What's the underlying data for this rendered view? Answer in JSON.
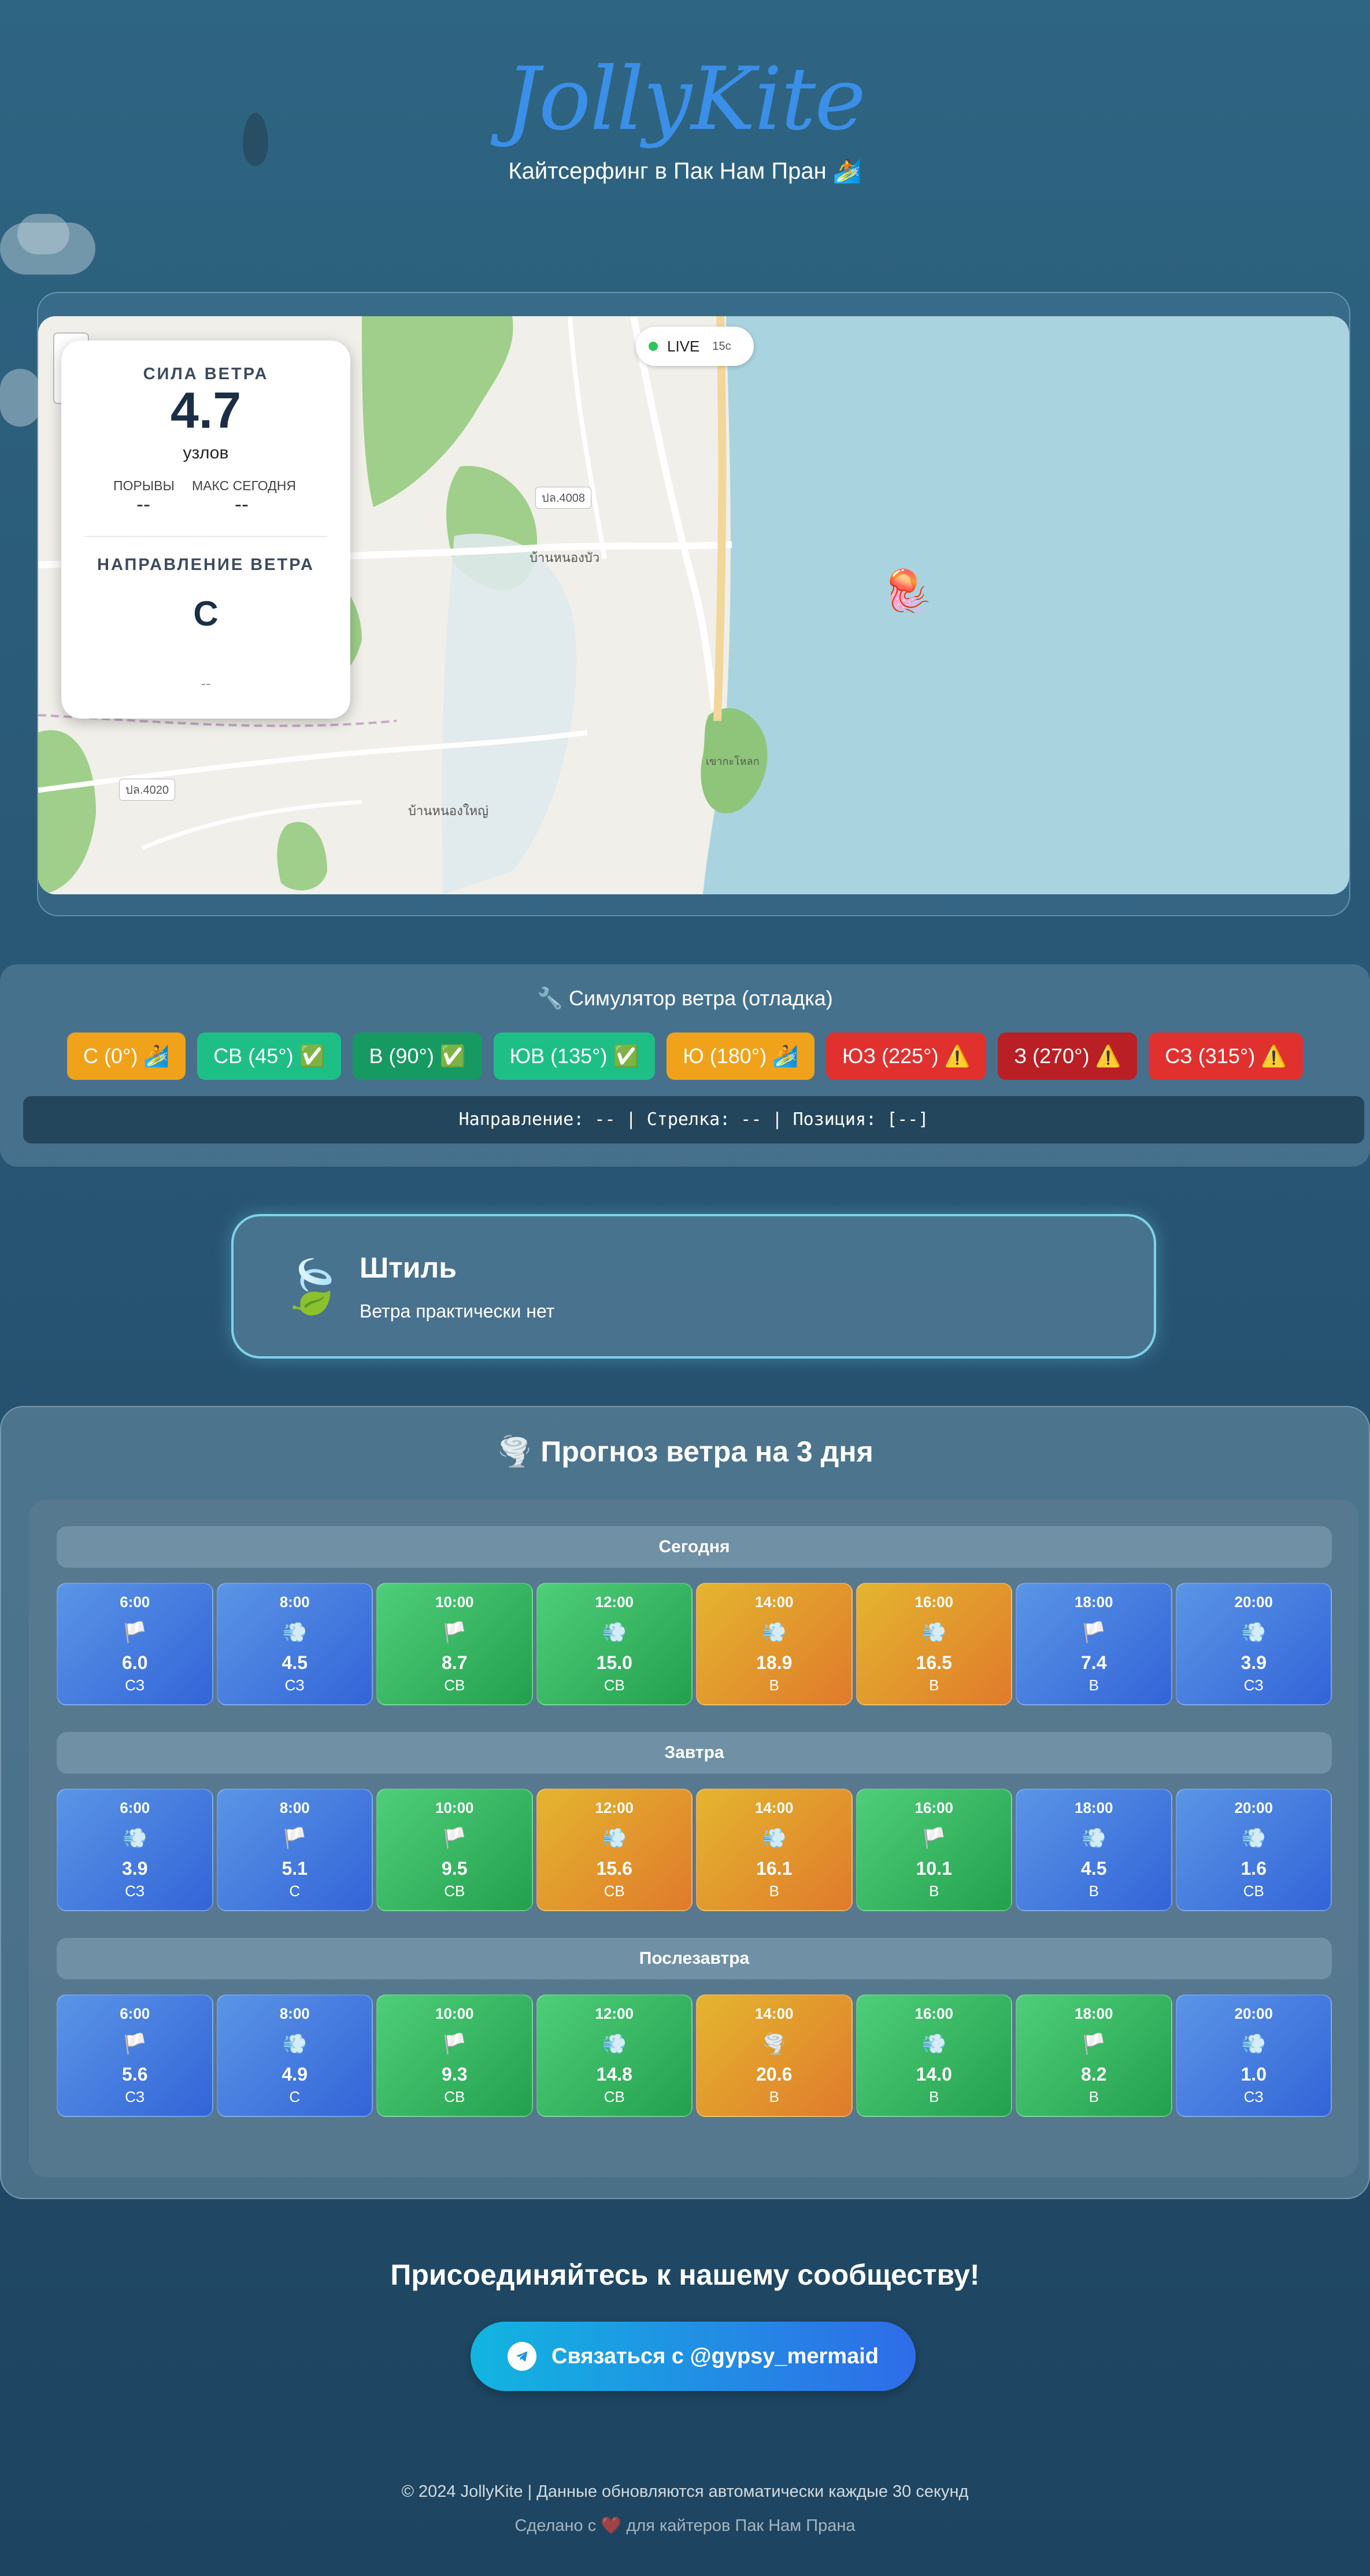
{
  "header": {
    "logo": "JollyKite",
    "subtitle": "Кайтсерфинг в Пак Нам Пран 🏄"
  },
  "map": {
    "live_label": "LIVE",
    "live_age": "15с",
    "place_labels": [
      "ปล.4008",
      "บ้านหนองบัว",
      "บ้านหนองใหญ่",
      "ปล.4020",
      "เขากะโหลก"
    ],
    "wind_card": {
      "speed_title": "СИЛА ВЕТРА",
      "speed_value": "4.7",
      "speed_unit": "узлов",
      "gusts_label": "ПОРЫВЫ",
      "gusts_value": "--",
      "max_today_label": "МАКС СЕГОДНЯ",
      "max_today_value": "--",
      "direction_title": "НАПРАВЛЕНИЕ ВЕТРА",
      "direction_value": "С",
      "direction_extra": "--"
    }
  },
  "simulator": {
    "title": "🔧 Симулятор ветра (отладка)",
    "buttons": [
      {
        "label": "С (0°)",
        "emoji": "🏄",
        "color": "#f0a21a"
      },
      {
        "label": "СВ (45°)",
        "emoji": "✅",
        "color": "#1dbf86"
      },
      {
        "label": "В (90°)",
        "emoji": "✅",
        "color": "#169a62"
      },
      {
        "label": "ЮВ (135°)",
        "emoji": "✅",
        "color": "#1dbf86"
      },
      {
        "label": "Ю (180°)",
        "emoji": "🏄",
        "color": "#f0a21a"
      },
      {
        "label": "ЮЗ (225°)",
        "emoji": "⚠️",
        "color": "#e0312f"
      },
      {
        "label": "З (270°)",
        "emoji": "⚠️",
        "color": "#b91f24"
      },
      {
        "label": "СЗ (315°)",
        "emoji": "⚠️",
        "color": "#e0312f"
      }
    ],
    "status": "Направление: -- | Стрелка: -- | Позиция: [--]"
  },
  "calm": {
    "icon": "🍃",
    "title": "Штиль",
    "description": "Ветра практически нет"
  },
  "forecast": {
    "title": "🌪️ Прогноз ветра на 3 дня",
    "days": [
      {
        "label": "Сегодня",
        "slots": [
          {
            "time": "6:00",
            "icon": "🏳️",
            "speed": "6.0",
            "dir": "СЗ",
            "level": "blue"
          },
          {
            "time": "8:00",
            "icon": "💨",
            "speed": "4.5",
            "dir": "СЗ",
            "level": "blue"
          },
          {
            "time": "10:00",
            "icon": "🏳️",
            "speed": "8.7",
            "dir": "СВ",
            "level": "green"
          },
          {
            "time": "12:00",
            "icon": "💨",
            "speed": "15.0",
            "dir": "СВ",
            "level": "green"
          },
          {
            "time": "14:00",
            "icon": "💨",
            "speed": "18.9",
            "dir": "В",
            "level": "orange"
          },
          {
            "time": "16:00",
            "icon": "💨",
            "speed": "16.5",
            "dir": "В",
            "level": "orange"
          },
          {
            "time": "18:00",
            "icon": "🏳️",
            "speed": "7.4",
            "dir": "В",
            "level": "blue"
          },
          {
            "time": "20:00",
            "icon": "💨",
            "speed": "3.9",
            "dir": "СЗ",
            "level": "blue"
          }
        ]
      },
      {
        "label": "Завтра",
        "slots": [
          {
            "time": "6:00",
            "icon": "💨",
            "speed": "3.9",
            "dir": "СЗ",
            "level": "blue"
          },
          {
            "time": "8:00",
            "icon": "🏳️",
            "speed": "5.1",
            "dir": "С",
            "level": "blue"
          },
          {
            "time": "10:00",
            "icon": "🏳️",
            "speed": "9.5",
            "dir": "СВ",
            "level": "green"
          },
          {
            "time": "12:00",
            "icon": "💨",
            "speed": "15.6",
            "dir": "СВ",
            "level": "orange"
          },
          {
            "time": "14:00",
            "icon": "💨",
            "speed": "16.1",
            "dir": "В",
            "level": "orange"
          },
          {
            "time": "16:00",
            "icon": "🏳️",
            "speed": "10.1",
            "dir": "В",
            "level": "green"
          },
          {
            "time": "18:00",
            "icon": "💨",
            "speed": "4.5",
            "dir": "В",
            "level": "blue"
          },
          {
            "time": "20:00",
            "icon": "💨",
            "speed": "1.6",
            "dir": "СВ",
            "level": "blue"
          }
        ]
      },
      {
        "label": "Послезавтра",
        "slots": [
          {
            "time": "6:00",
            "icon": "🏳️",
            "speed": "5.6",
            "dir": "СЗ",
            "level": "blue"
          },
          {
            "time": "8:00",
            "icon": "💨",
            "speed": "4.9",
            "dir": "С",
            "level": "blue"
          },
          {
            "time": "10:00",
            "icon": "🏳️",
            "speed": "9.3",
            "dir": "СВ",
            "level": "green"
          },
          {
            "time": "12:00",
            "icon": "💨",
            "speed": "14.8",
            "dir": "СВ",
            "level": "green"
          },
          {
            "time": "14:00",
            "icon": "🌪️",
            "speed": "20.6",
            "dir": "В",
            "level": "orange"
          },
          {
            "time": "16:00",
            "icon": "💨",
            "speed": "14.0",
            "dir": "В",
            "level": "green"
          },
          {
            "time": "18:00",
            "icon": "🏳️",
            "speed": "8.2",
            "dir": "В",
            "level": "green"
          },
          {
            "time": "20:00",
            "icon": "💨",
            "speed": "1.0",
            "dir": "СЗ",
            "level": "blue"
          }
        ]
      }
    ]
  },
  "community": {
    "title": "Присоединяйтесь к нашему сообществу!",
    "button_label": "Связаться с @gypsy_mermaid"
  },
  "footer": {
    "line1": "© 2024 JollyKite | Данные обновляются автоматически каждые 30 секунд",
    "line2": "Сделано с ❤️ для кайтеров Пак Нам Прана"
  }
}
